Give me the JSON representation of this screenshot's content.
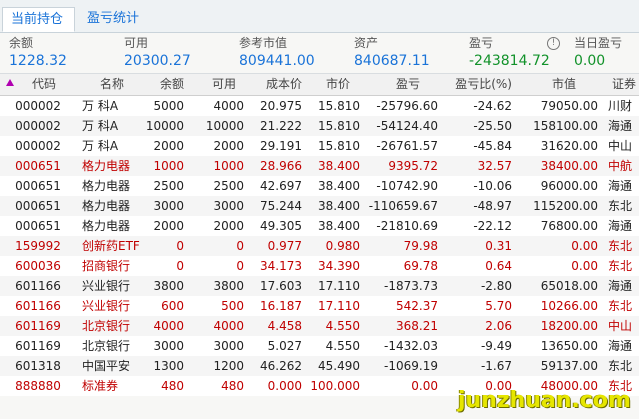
{
  "tabs": [
    {
      "label": "当前持仓",
      "active": true
    },
    {
      "label": "盈亏统计",
      "active": false
    }
  ],
  "summary": [
    {
      "label": "余额",
      "value": "1228.32"
    },
    {
      "label": "可用",
      "value": "20300.27"
    },
    {
      "label": "参考市值",
      "value": "809441.00"
    },
    {
      "label": "资产",
      "value": "840687.11"
    },
    {
      "label": "盈亏",
      "value": "-243814.72"
    },
    {
      "label": "当日盈亏",
      "value": "0.00"
    }
  ],
  "info_icon": "info-icon",
  "colors": {
    "accent": "#1a73d8",
    "negative": "#12922a",
    "highlight": "#c00000"
  },
  "table": {
    "columns": [
      "代码",
      "名称",
      "余额",
      "可用",
      "成本价",
      "市价",
      "盈亏",
      "盈亏比(%)",
      "市值",
      "证券"
    ],
    "rows": [
      {
        "code": "000002",
        "name": "万  科A",
        "balance": "5000",
        "available": "4000",
        "cost": "20.975",
        "price": "15.810",
        "pl": "-25796.60",
        "plpct": "-24.62",
        "mv": "79050.00",
        "market": "川财",
        "hl": false
      },
      {
        "code": "000002",
        "name": "万  科A",
        "balance": "10000",
        "available": "10000",
        "cost": "21.222",
        "price": "15.810",
        "pl": "-54124.40",
        "plpct": "-25.50",
        "mv": "158100.00",
        "market": "海通",
        "hl": false
      },
      {
        "code": "000002",
        "name": "万  科A",
        "balance": "2000",
        "available": "2000",
        "cost": "29.191",
        "price": "15.810",
        "pl": "-26761.57",
        "plpct": "-45.84",
        "mv": "31620.00",
        "market": "中山",
        "hl": false
      },
      {
        "code": "000651",
        "name": "格力电器",
        "balance": "1000",
        "available": "1000",
        "cost": "28.966",
        "price": "38.400",
        "pl": "9395.72",
        "plpct": "32.57",
        "mv": "38400.00",
        "market": "中航",
        "hl": true
      },
      {
        "code": "000651",
        "name": "格力电器",
        "balance": "2500",
        "available": "2500",
        "cost": "42.697",
        "price": "38.400",
        "pl": "-10742.90",
        "plpct": "-10.06",
        "mv": "96000.00",
        "market": "海通",
        "hl": false
      },
      {
        "code": "000651",
        "name": "格力电器",
        "balance": "3000",
        "available": "3000",
        "cost": "75.244",
        "price": "38.400",
        "pl": "-110659.67",
        "plpct": "-48.97",
        "mv": "115200.00",
        "market": "东北",
        "hl": false
      },
      {
        "code": "000651",
        "name": "格力电器",
        "balance": "2000",
        "available": "2000",
        "cost": "49.305",
        "price": "38.400",
        "pl": "-21810.69",
        "plpct": "-22.12",
        "mv": "76800.00",
        "market": "海通",
        "hl": false
      },
      {
        "code": "159992",
        "name": "创新药ETF",
        "balance": "0",
        "available": "0",
        "cost": "0.977",
        "price": "0.980",
        "pl": "79.98",
        "plpct": "0.31",
        "mv": "0.00",
        "market": "东北",
        "hl": true
      },
      {
        "code": "600036",
        "name": "招商银行",
        "balance": "0",
        "available": "0",
        "cost": "34.173",
        "price": "34.390",
        "pl": "69.78",
        "plpct": "0.64",
        "mv": "0.00",
        "market": "东北",
        "hl": true
      },
      {
        "code": "601166",
        "name": "兴业银行",
        "balance": "3800",
        "available": "3800",
        "cost": "17.603",
        "price": "17.110",
        "pl": "-1873.73",
        "plpct": "-2.80",
        "mv": "65018.00",
        "market": "海通",
        "hl": false
      },
      {
        "code": "601166",
        "name": "兴业银行",
        "balance": "600",
        "available": "500",
        "cost": "16.187",
        "price": "17.110",
        "pl": "542.37",
        "plpct": "5.70",
        "mv": "10266.00",
        "market": "东北",
        "hl": true
      },
      {
        "code": "601169",
        "name": "北京银行",
        "balance": "4000",
        "available": "4000",
        "cost": "4.458",
        "price": "4.550",
        "pl": "368.21",
        "plpct": "2.06",
        "mv": "18200.00",
        "market": "中山",
        "hl": true
      },
      {
        "code": "601169",
        "name": "北京银行",
        "balance": "3000",
        "available": "3000",
        "cost": "5.027",
        "price": "4.550",
        "pl": "-1432.03",
        "plpct": "-9.49",
        "mv": "13650.00",
        "market": "海通",
        "hl": false
      },
      {
        "code": "601318",
        "name": "中国平安",
        "balance": "1300",
        "available": "1200",
        "cost": "46.262",
        "price": "45.490",
        "pl": "-1069.19",
        "plpct": "-1.67",
        "mv": "59137.00",
        "market": "东北",
        "hl": false
      },
      {
        "code": "888880",
        "name": "标准券",
        "balance": "480",
        "available": "480",
        "cost": "0.000",
        "price": "100.000",
        "pl": "0.00",
        "plpct": "0.00",
        "mv": "48000.00",
        "market": "东北",
        "hl": true
      }
    ]
  },
  "watermark": "junzhuan.com"
}
